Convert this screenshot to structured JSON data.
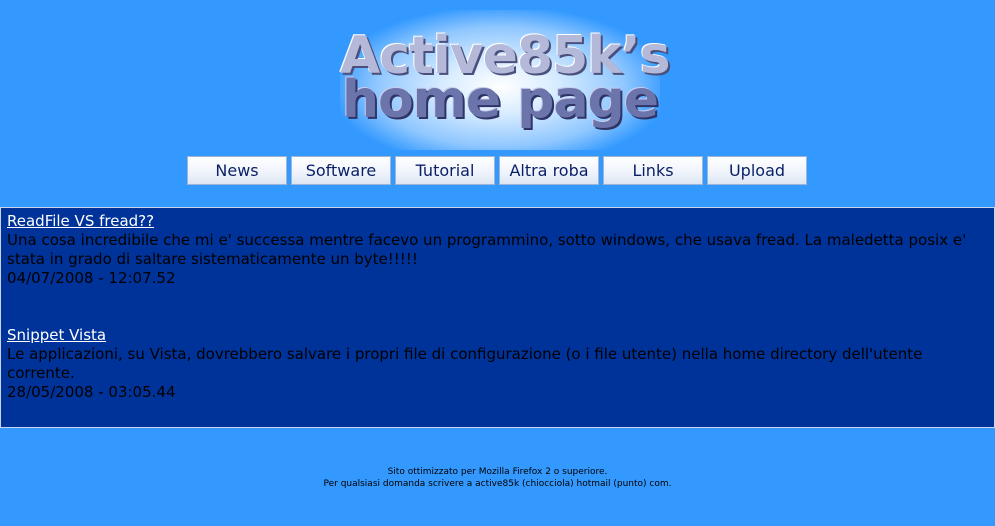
{
  "logo": {
    "line1": "Active85k’s",
    "line2": "home page"
  },
  "nav": {
    "items": [
      {
        "label": "News"
      },
      {
        "label": "Software"
      },
      {
        "label": "Tutorial"
      },
      {
        "label": "Altra roba"
      },
      {
        "label": "Links"
      },
      {
        "label": "Upload"
      }
    ]
  },
  "news": [
    {
      "title": "ReadFile VS fread??",
      "body": "Una cosa incredibile che mi e' successa mentre facevo un programmino, sotto windows, che usava fread. La maledetta posix e' stata in grado di saltare sistematicamente un byte!!!!!",
      "date": "04/07/2008 - 12:07.52"
    },
    {
      "title": "Snippet Vista",
      "body": "Le applicazioni, su Vista, dovrebbero salvare i propri file di configurazione (o i file utente) nella home directory dell'utente corrente.",
      "date": "28/05/2008 - 03:05.44"
    }
  ],
  "footer": {
    "line1": "Sito ottimizzato per Mozilla Firefox 2 o superiore.",
    "line2": "Per qualsiasi domanda scrivere a active85k (chiocciola) hotmail (punto) com."
  },
  "colors": {
    "page_background": "#3399ff",
    "content_background": "#00339a",
    "link": "#ffffff"
  }
}
